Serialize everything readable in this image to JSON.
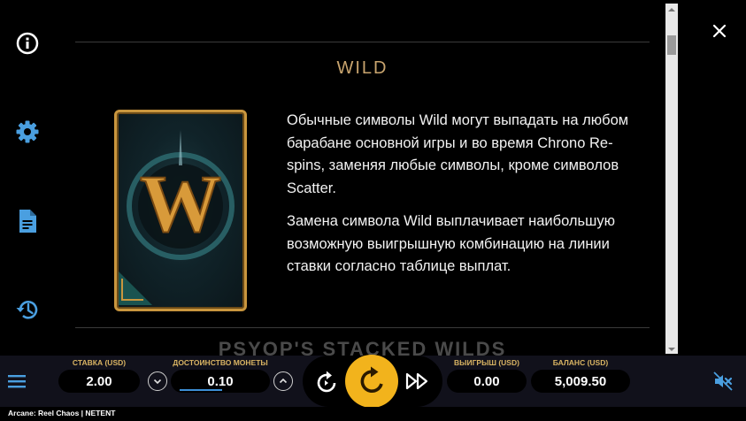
{
  "sidebar": {
    "items": [
      {
        "icon": "info-icon"
      },
      {
        "icon": "gear-icon"
      },
      {
        "icon": "document-icon"
      },
      {
        "icon": "history-icon"
      }
    ]
  },
  "panel": {
    "section_title": "WILD",
    "paragraphs": [
      "Обычные символы Wild могут выпадать на любом барабане основной игры и во время Chrono Re-spins, заменяя любые символы, кроме символов Scatter.",
      "Замена символа Wild выплачивает наибольшую возможную выигрышную комбинацию на линии ставки согласно таблице выплат."
    ],
    "next_section_title": "PSYOP'S STACKED WILDS",
    "card_letter": "W"
  },
  "bottombar": {
    "bet_label": "СТАВКА (USD)",
    "bet_value": "2.00",
    "coin_label": "ДОСТОИНСТВО МОНЕТЫ",
    "coin_value": "0.10",
    "win_label": "ВЫИГРЫШ (USD)",
    "win_value": "0.00",
    "balance_label": "БАЛАНС (USD)",
    "balance_value": "5,009.50"
  },
  "footer": {
    "text": "Arcane: Reel Chaos  |  NETENT"
  },
  "colors": {
    "accent_gold": "#c8a46e",
    "spin_yellow": "#f2b31c",
    "label_gold": "#d9b463",
    "coin_underline": "#3d8fd6"
  }
}
